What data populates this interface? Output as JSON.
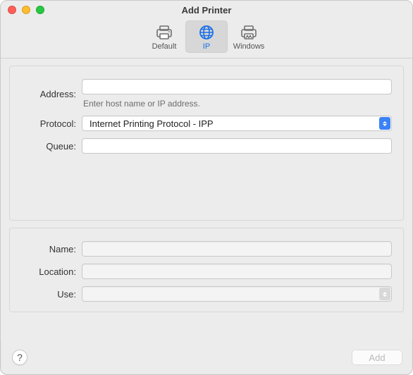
{
  "window": {
    "title": "Add Printer"
  },
  "toolbar": {
    "items": [
      {
        "label": "Default"
      },
      {
        "label": "IP"
      },
      {
        "label": "Windows"
      }
    ],
    "selected_index": 1
  },
  "form_top": {
    "address_label": "Address:",
    "address_value": "",
    "address_hint": "Enter host name or IP address.",
    "protocol_label": "Protocol:",
    "protocol_value": "Internet Printing Protocol - IPP",
    "queue_label": "Queue:",
    "queue_value": ""
  },
  "form_bottom": {
    "name_label": "Name:",
    "name_value": "",
    "location_label": "Location:",
    "location_value": "",
    "use_label": "Use:",
    "use_value": ""
  },
  "footer": {
    "help_label": "?",
    "add_label": "Add"
  }
}
